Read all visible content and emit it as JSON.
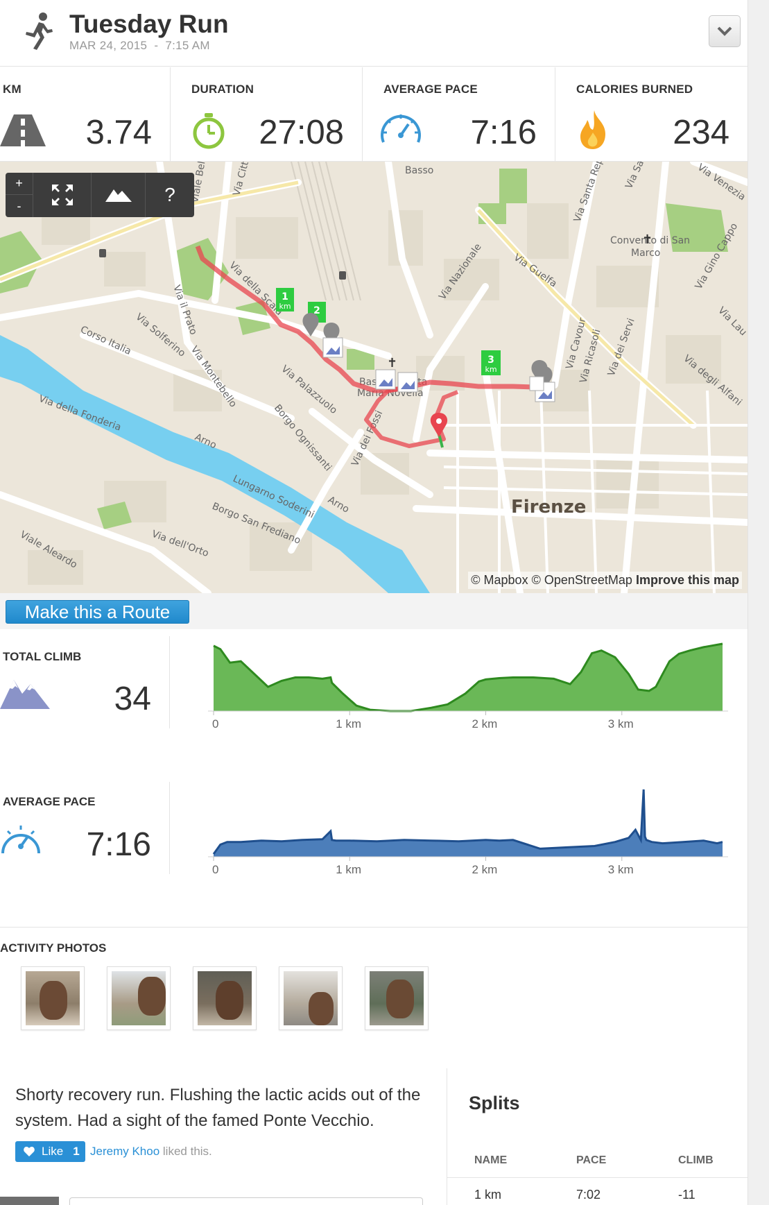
{
  "header": {
    "title": "Tuesday Run",
    "date": "MAR 24, 2015",
    "separator": "-",
    "time": "7:15 AM"
  },
  "stats": [
    {
      "label": "KM",
      "value": "3.74",
      "icon": "road-icon"
    },
    {
      "label": "DURATION",
      "value": "27:08",
      "icon": "stopwatch-icon"
    },
    {
      "label": "AVERAGE PACE",
      "value": "7:16",
      "icon": "speedometer-icon"
    },
    {
      "label": "CALORIES BURNED",
      "value": "234",
      "icon": "flame-icon"
    }
  ],
  "map": {
    "controls": {
      "zoom_in": "+",
      "zoom_out": "-",
      "help": "?"
    },
    "markers": [
      "1",
      "km",
      "2",
      "3",
      "km"
    ],
    "labels": {
      "basso": "Basso",
      "via_della_scala": "Via della Scala",
      "via_nazionale": "Via Nazionale",
      "via_guelfa": "Via Guelfa",
      "via_santa_repa": "Via Santa Repa",
      "via_san": "Via San",
      "via_venezia": "Via Venezia",
      "convento": "Convento di San",
      "convento2": "Marco",
      "via_gino_cappo": "Via Gino Cappo",
      "via_il_prato": "Via il Prato",
      "via_solferino": "Via Solferino",
      "corso_italia": "Corso Italia",
      "via_montebello": "Via Montebello",
      "via_palazzuolo": "Via Palazzuolo",
      "borgo_ognissanti": "Borgo Ognissanti",
      "via_dei_fossi": "Via dei Fossi",
      "via_della_fonderia": "Via della Fonderia",
      "arno1": "Arno",
      "arno2": "Arno",
      "lungarno_soderini": "Lungarno Soderini",
      "borgo_san_frediano": "Borgo San Frediano",
      "viale_aleardo": "Viale Aleardo",
      "via_dell_orto": "Via dell'Orto",
      "basilica": "Basilica Santa",
      "basilica2": "Maria Novella",
      "via_cavour": "Via Cavour",
      "via_ricasoli": "Via Ricasoli",
      "via_dei_servi": "Via dei Servi",
      "via_degli_alfani": "Via degli Alfani",
      "via_lau": "Via Lau",
      "via_belfiore": "Viale Belfiore",
      "via_citt": "Via Citt",
      "firenze": "Firenze"
    },
    "attribution": {
      "mapbox": "© Mapbox",
      "osm": "© OpenStreetMap",
      "improve": "Improve this map"
    }
  },
  "route_button": "Make this a Route",
  "climb": {
    "label": "TOTAL CLIMB",
    "value": "34",
    "icon": "mountain-icon"
  },
  "pace": {
    "label": "AVERAGE PACE",
    "value": "7:16",
    "icon": "speedometer-icon"
  },
  "chart_data": [
    {
      "type": "area",
      "title": "",
      "xlabel": "",
      "ylabel": "",
      "x_ticks": [
        "0",
        "1 km",
        "2 km",
        "3 km"
      ],
      "xlim": [
        0,
        3.74
      ],
      "ylim": [
        0,
        1
      ],
      "color": "#6ab857",
      "line_color": "#2e8a1f",
      "x": [
        0,
        0.05,
        0.12,
        0.2,
        0.3,
        0.4,
        0.5,
        0.6,
        0.7,
        0.8,
        0.86,
        0.87,
        0.95,
        1.05,
        1.15,
        1.3,
        1.45,
        1.6,
        1.72,
        1.85,
        1.95,
        2.0,
        2.1,
        2.2,
        2.35,
        2.5,
        2.62,
        2.7,
        2.78,
        2.85,
        2.95,
        3.05,
        3.12,
        3.2,
        3.25,
        3.3,
        3.35,
        3.42,
        3.5,
        3.6,
        3.74
      ],
      "values": [
        0.97,
        0.92,
        0.72,
        0.74,
        0.55,
        0.36,
        0.45,
        0.5,
        0.5,
        0.48,
        0.5,
        0.42,
        0.26,
        0.08,
        0.02,
        0.0,
        0.0,
        0.05,
        0.1,
        0.26,
        0.44,
        0.47,
        0.49,
        0.5,
        0.5,
        0.48,
        0.4,
        0.58,
        0.86,
        0.9,
        0.8,
        0.55,
        0.32,
        0.3,
        0.36,
        0.55,
        0.74,
        0.85,
        0.9,
        0.95,
        1.0
      ]
    },
    {
      "type": "area",
      "title": "",
      "xlabel": "",
      "ylabel": "",
      "x_ticks": [
        "0",
        "1 km",
        "2 km",
        "3 km"
      ],
      "xlim": [
        0,
        3.74
      ],
      "ylim": [
        0,
        1
      ],
      "color": "#4c7eba",
      "line_color": "#1f4f8e",
      "x": [
        0,
        0.05,
        0.1,
        0.2,
        0.35,
        0.5,
        0.65,
        0.8,
        0.86,
        0.87,
        0.9,
        1.0,
        1.2,
        1.4,
        1.6,
        1.8,
        2.0,
        2.1,
        2.2,
        2.4,
        2.6,
        2.8,
        2.95,
        3.05,
        3.1,
        3.14,
        3.16,
        3.17,
        3.18,
        3.22,
        3.3,
        3.45,
        3.6,
        3.7,
        3.74
      ],
      "values": [
        0.04,
        0.18,
        0.22,
        0.22,
        0.24,
        0.23,
        0.25,
        0.26,
        0.38,
        0.25,
        0.24,
        0.24,
        0.23,
        0.25,
        0.24,
        0.23,
        0.25,
        0.24,
        0.25,
        0.12,
        0.14,
        0.16,
        0.22,
        0.28,
        0.4,
        0.25,
        1.0,
        0.3,
        0.25,
        0.22,
        0.2,
        0.22,
        0.24,
        0.2,
        0.22
      ]
    }
  ],
  "photos_label": "ACTIVITY PHOTOS",
  "photos": [
    "photo-1",
    "photo-2",
    "photo-3",
    "photo-4",
    "photo-5"
  ],
  "description": "Shorty recovery run. Flushing the lactic acids out of the system. Had a sight of the famed Ponte Vecchio.",
  "like": {
    "label": "Like",
    "count": "1",
    "liker": "Jeremy Khoo",
    "suffix": "liked this."
  },
  "splits": {
    "title": "Splits",
    "columns": [
      "NAME",
      "PACE",
      "CLIMB"
    ],
    "rows": [
      [
        "1 km",
        "7:02",
        "-11"
      ]
    ]
  }
}
